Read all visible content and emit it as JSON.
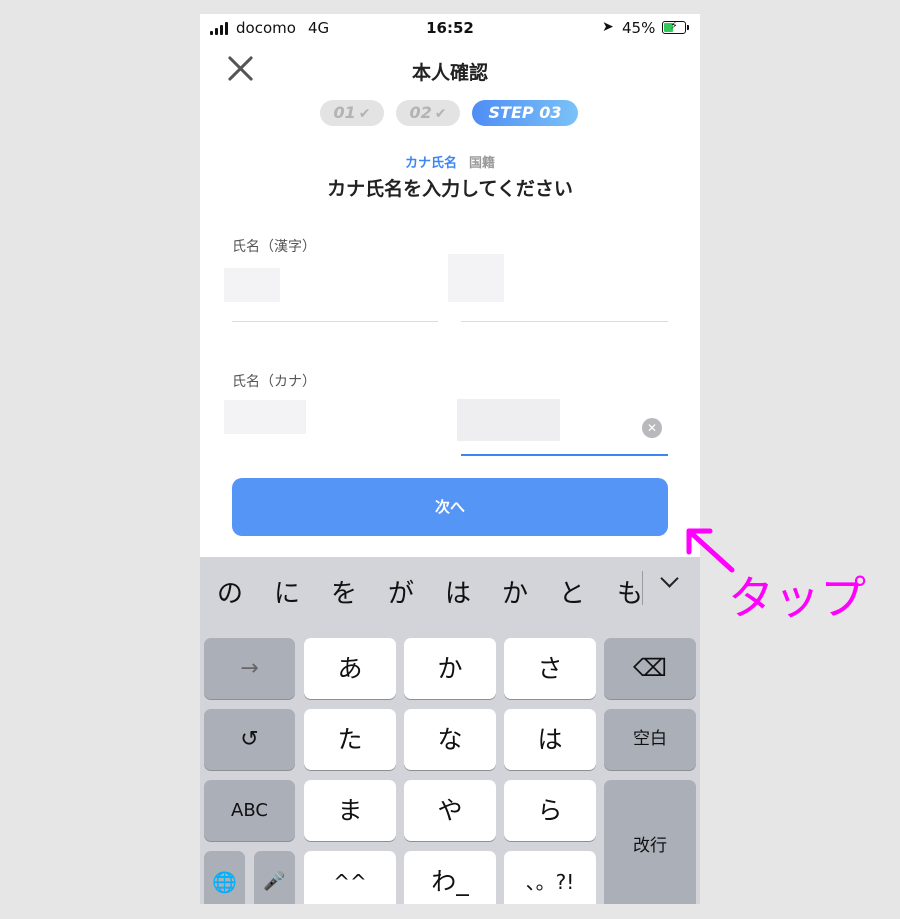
{
  "status_bar": {
    "carrier": "docomo",
    "network": "4G",
    "time": "16:52",
    "battery_percent": "45%",
    "battery_level": 0.45,
    "location_icon": "location-arrow-icon"
  },
  "header": {
    "title": "本人確認",
    "close_icon": "close-icon"
  },
  "steps": [
    {
      "label": "01",
      "state": "done"
    },
    {
      "label": "02",
      "state": "done"
    },
    {
      "label": "STEP 03",
      "state": "current"
    }
  ],
  "subtabs": {
    "active": "カナ氏名",
    "inactive": "国籍"
  },
  "heading": "カナ氏名を入力してください",
  "form": {
    "kanji_label": "氏名（漢字）",
    "kana_label": "氏名（カナ）"
  },
  "next_button": "次へ",
  "keyboard": {
    "candidates": [
      "の",
      "に",
      "を",
      "が",
      "は",
      "か",
      "と",
      "も"
    ],
    "rows": [
      [
        "→",
        "あ",
        "か",
        "さ",
        "⌫"
      ],
      [
        "↺",
        "た",
        "な",
        "は",
        "空白"
      ],
      [
        "ABC",
        "ま",
        "や",
        "ら",
        "改行"
      ],
      [
        "🌐",
        "🎤",
        "^^",
        "わ_",
        "、。?!"
      ]
    ]
  },
  "annotation": {
    "text": "タップ",
    "color": "#ff00ff"
  },
  "colors": {
    "accent": "#3d86f2",
    "button": "#5595f6"
  }
}
